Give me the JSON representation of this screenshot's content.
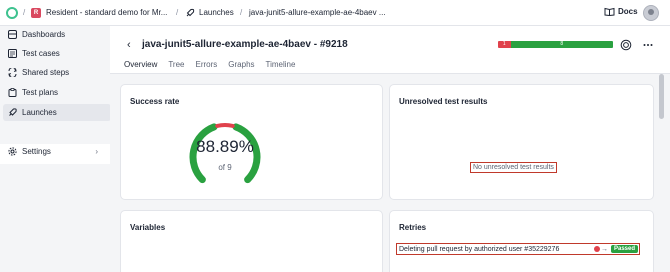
{
  "topbar": {
    "project_badge": "R",
    "project_name": "Resident - standard demo for Mr...",
    "section": "Launches",
    "launch_short": "java-junit5-allure-example-ae-4baev ...",
    "docs_label": "Docs"
  },
  "sidebar": {
    "items": [
      {
        "label": "Dashboards"
      },
      {
        "label": "Test cases"
      },
      {
        "label": "Shared steps"
      },
      {
        "label": "Test plans"
      },
      {
        "label": "Launches"
      },
      {
        "label": "Settings"
      }
    ]
  },
  "launch": {
    "title": "java-junit5-allure-example-ae-4baev - #9218",
    "failed_count": "1",
    "passed_count": "8",
    "failed_fraction": 0.11,
    "passed_fraction": 0.89
  },
  "tabs": [
    "Overview",
    "Tree",
    "Errors",
    "Graphs",
    "Timeline"
  ],
  "success_rate": {
    "title": "Success rate",
    "value": "88.89%",
    "sub": "of 9",
    "passed_fraction": 0.8889
  },
  "unresolved": {
    "title": "Unresolved test results",
    "empty_text": "No unresolved test results"
  },
  "variables": {
    "title": "Variables"
  },
  "retries": {
    "title": "Retries",
    "row_text": "Deleting pull request by authorized user #35229276",
    "status": "Passed"
  },
  "colors": {
    "passed": "#2aa140",
    "failed": "#e0424c",
    "logo": "#3ec28f",
    "project_badge": "#d9485f"
  }
}
